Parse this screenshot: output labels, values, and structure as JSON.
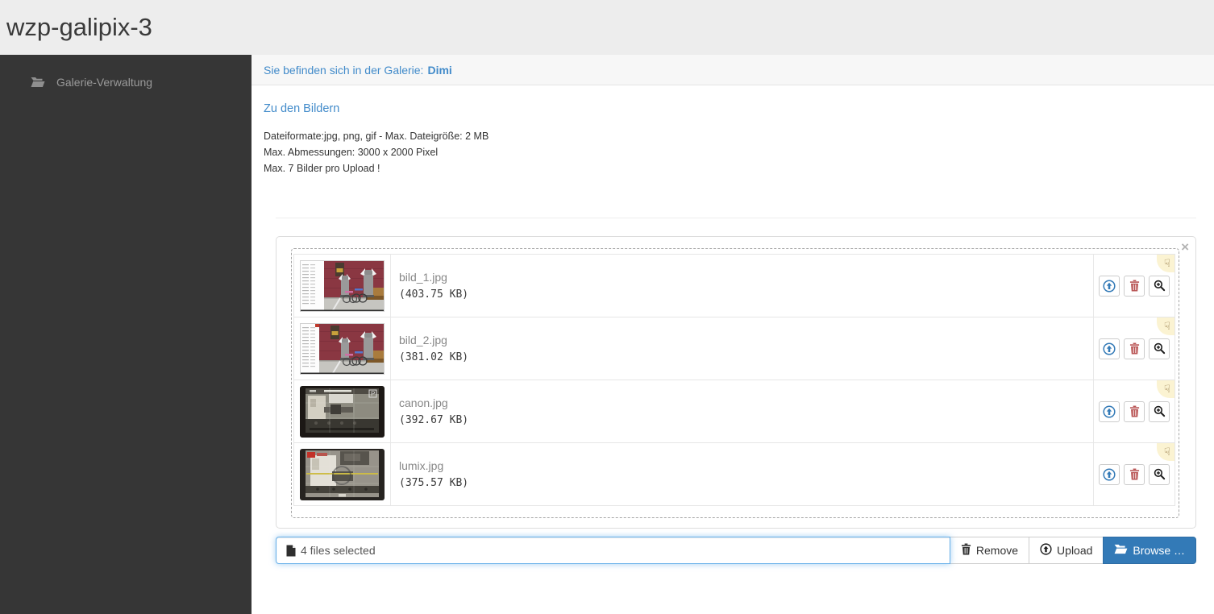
{
  "app": {
    "title": "wzp-galipix-3"
  },
  "sidebar": {
    "items": [
      {
        "label": "Galerie-Verwaltung",
        "icon": "folder-open-icon"
      }
    ]
  },
  "breadcrumb": {
    "prefix": "Sie befinden sich in der Galerie:",
    "gallery": "Dimi"
  },
  "main": {
    "link_label": "Zu den Bildern",
    "info_lines": [
      "Dateiformate:jpg, png, gif - Max. Dateigröße: 2 MB",
      "Max. Abmessungen: 3000 x 2000 Pixel",
      "Max. 7 Bilder pro Upload !"
    ]
  },
  "uploader": {
    "files": [
      {
        "name": "bild_1.jpg",
        "size": "(403.75 KB)",
        "thumb": "vikings1"
      },
      {
        "name": "bild_2.jpg",
        "size": "(381.02 KB)",
        "thumb": "vikings2"
      },
      {
        "name": "canon.jpg",
        "size": "(392.67 KB)",
        "thumb": "canon"
      },
      {
        "name": "lumix.jpg",
        "size": "(375.57 KB)",
        "thumb": "lumix"
      }
    ],
    "caption": "4 files selected",
    "close_symbol": "×",
    "drag_symbol": "☟",
    "buttons": {
      "remove": "Remove",
      "upload": "Upload",
      "browse": "Browse …"
    }
  },
  "colors": {
    "accent": "#337ab7",
    "accent_border": "#2e6da4",
    "link": "#428bca",
    "header_bg": "#ededed",
    "sidebar_bg": "#363636",
    "focus_glow": "#66afe9",
    "drag_bg": "#fbf3d2",
    "trash_red": "#b85353"
  }
}
